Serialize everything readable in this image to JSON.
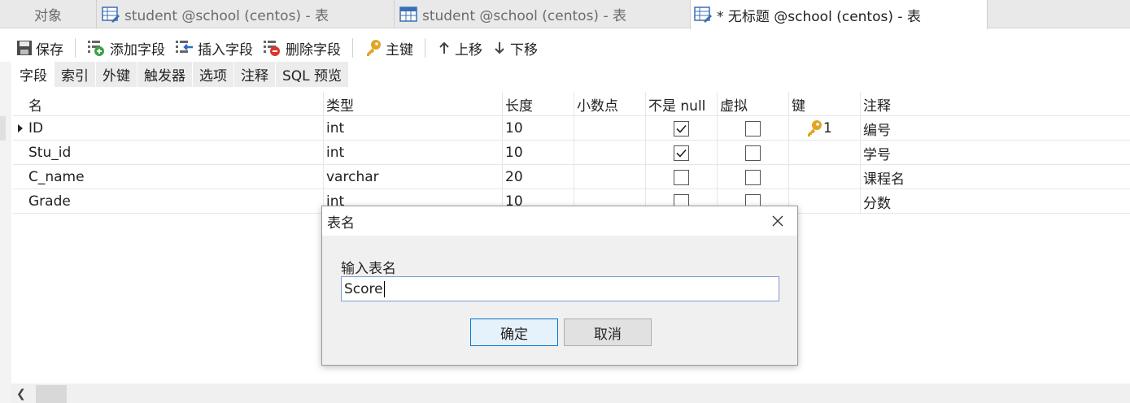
{
  "tabs": [
    {
      "label": "对象",
      "icon": ""
    },
    {
      "label": "student @school (centos) - 表",
      "icon": "table-edit-icon"
    },
    {
      "label": "student @school (centos) - 表",
      "icon": "table-icon"
    },
    {
      "label": "* 无标题 @school (centos) - 表",
      "icon": "table-edit-icon"
    }
  ],
  "toolbar": {
    "save": "保存",
    "add_field": "添加字段",
    "insert_field": "插入字段",
    "delete_field": "删除字段",
    "primary_key": "主键",
    "move_up": "上移",
    "move_down": "下移"
  },
  "subtabs": [
    "字段",
    "索引",
    "外键",
    "触发器",
    "选项",
    "注释",
    "SQL 预览"
  ],
  "grid": {
    "headers": {
      "name": "名",
      "type": "类型",
      "length": "长度",
      "decimals": "小数点",
      "not_null": "不是 null",
      "virtual": "虚拟",
      "key": "键",
      "comment": "注释"
    },
    "rows": [
      {
        "name": "ID",
        "type": "int",
        "length": "10",
        "decimals": "",
        "not_null": true,
        "virtual": false,
        "key": "1",
        "comment": "编号"
      },
      {
        "name": "Stu_id",
        "type": "int",
        "length": "10",
        "decimals": "",
        "not_null": true,
        "virtual": false,
        "key": "",
        "comment": "学号"
      },
      {
        "name": "C_name",
        "type": "varchar",
        "length": "20",
        "decimals": "",
        "not_null": false,
        "virtual": false,
        "key": "",
        "comment": "课程名"
      },
      {
        "name": "Grade",
        "type": "int",
        "length": "10",
        "decimals": "",
        "not_null": false,
        "virtual": false,
        "key": "",
        "comment": "分数"
      }
    ]
  },
  "dialog": {
    "title": "表名",
    "label": "输入表名",
    "value": "Score",
    "ok": "确定",
    "cancel": "取消"
  },
  "colors": {
    "key_gold": "#e0a526",
    "ok_border": "#0078d7"
  }
}
